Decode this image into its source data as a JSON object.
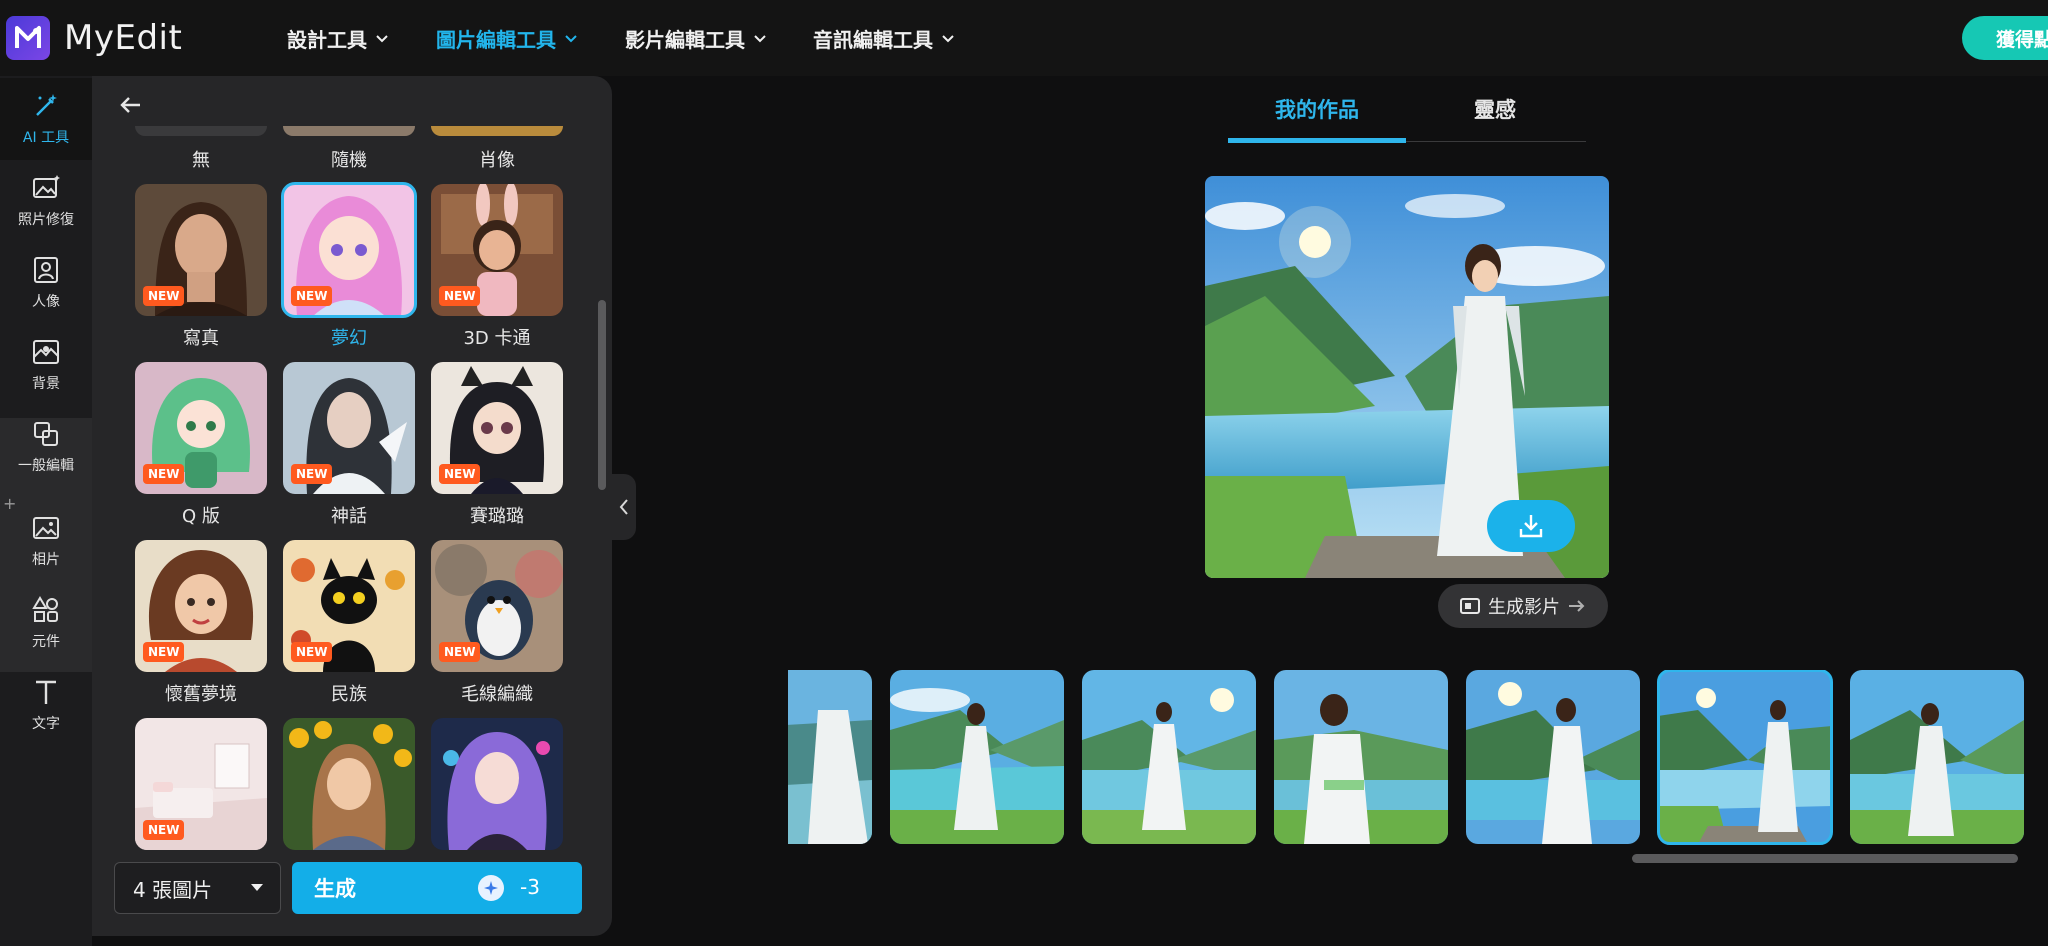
{
  "app": {
    "logo_letter": "M",
    "name": "MyEdit"
  },
  "nav": [
    {
      "label": "設計工具",
      "active": false
    },
    {
      "label": "圖片編輯工具",
      "active": true
    },
    {
      "label": "影片編輯工具",
      "active": false
    },
    {
      "label": "音訊編輯工具",
      "active": false
    }
  ],
  "cta": {
    "label": "獲得點"
  },
  "rail": {
    "items": [
      {
        "label": "AI 工具",
        "icon": "magic-wand-icon"
      },
      {
        "label": "照片修復",
        "icon": "photo-sparkle-icon"
      },
      {
        "label": "人像",
        "icon": "portrait-icon"
      },
      {
        "label": "背景",
        "icon": "background-icon"
      },
      {
        "label": "一般編輯",
        "icon": "crop-icon"
      },
      {
        "label": "相片",
        "icon": "image-icon"
      },
      {
        "label": "元件",
        "icon": "shapes-icon"
      },
      {
        "label": "文字",
        "icon": "text-icon"
      }
    ],
    "plus": "+"
  },
  "styles": {
    "partial_row": [
      "無",
      "隨機",
      "肖像"
    ],
    "cards": [
      {
        "label": "寫真",
        "badge": "NEW",
        "selected": false
      },
      {
        "label": "夢幻",
        "badge": "NEW",
        "selected": true
      },
      {
        "label": "3D 卡通",
        "badge": "NEW",
        "selected": false
      },
      {
        "label": "Q 版",
        "badge": "NEW",
        "selected": false
      },
      {
        "label": "神話",
        "badge": "NEW",
        "selected": false
      },
      {
        "label": "賽璐璐",
        "badge": "NEW",
        "selected": false
      },
      {
        "label": "懷舊夢境",
        "badge": "NEW",
        "selected": false
      },
      {
        "label": "民族",
        "badge": "NEW",
        "selected": false
      },
      {
        "label": "毛線編織",
        "badge": "NEW",
        "selected": false
      },
      {
        "label": "",
        "badge": "NEW",
        "selected": false
      },
      {
        "label": "",
        "badge": "",
        "selected": false
      },
      {
        "label": "",
        "badge": "",
        "selected": false
      }
    ]
  },
  "generate": {
    "count_label": "4 張圖片",
    "button_label": "生成",
    "credits": "-3"
  },
  "tabs": [
    {
      "label": "我的作品",
      "active": true
    },
    {
      "label": "靈感",
      "active": false
    }
  ],
  "preview": {
    "video_button": "生成影片"
  },
  "strip": {
    "selected_index": 5,
    "count": 7
  }
}
